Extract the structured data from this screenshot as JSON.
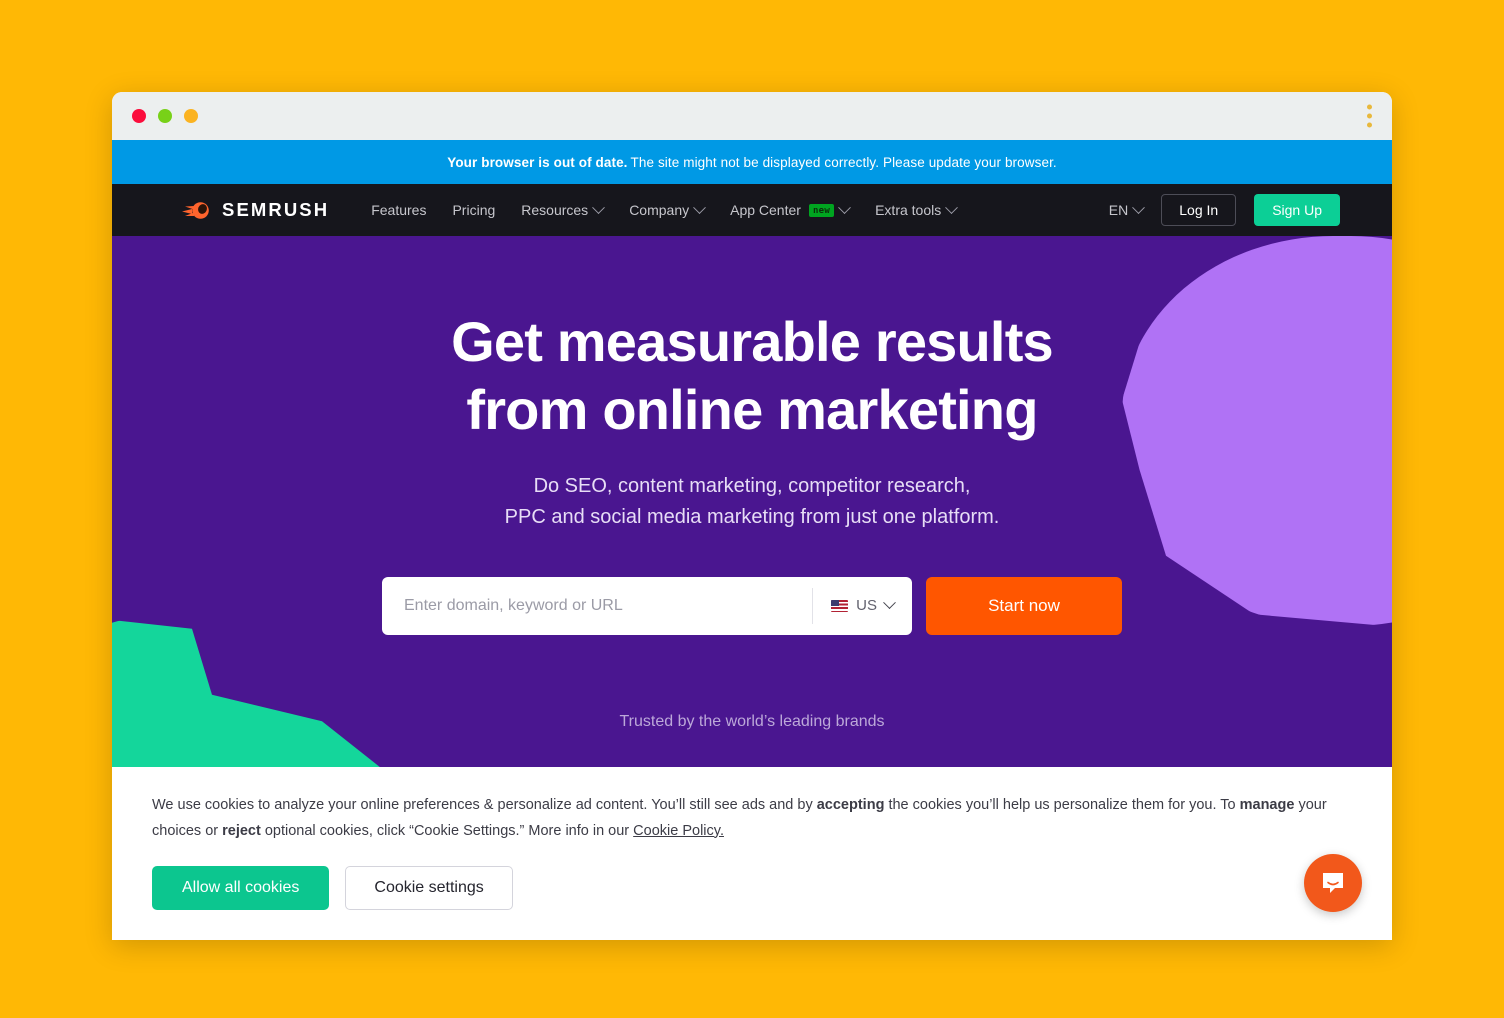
{
  "page": {
    "background_color": "#FFB805"
  },
  "browser": {
    "traffic_lights": [
      "close",
      "minimize",
      "maximize"
    ],
    "menu_icon": "kebab-menu-icon"
  },
  "notice": {
    "bold": "Your browser is out of date.",
    "rest": "The site might not be displayed correctly. Please update your browser.",
    "background_color": "#0099E5"
  },
  "nav": {
    "background_color": "#16161C",
    "logo_text": "SEMRUSH",
    "links": [
      {
        "label": "Features",
        "has_chevron": false,
        "badge": null
      },
      {
        "label": "Pricing",
        "has_chevron": false,
        "badge": null
      },
      {
        "label": "Resources",
        "has_chevron": true,
        "badge": null
      },
      {
        "label": "Company",
        "has_chevron": true,
        "badge": null
      },
      {
        "label": "App Center",
        "has_chevron": true,
        "badge": "new"
      },
      {
        "label": "Extra tools",
        "has_chevron": true,
        "badge": null
      }
    ],
    "language": "EN",
    "login_label": "Log In",
    "signup_label": "Sign Up",
    "signup_color": "#0CCF96"
  },
  "hero": {
    "background_color": "#4A1690",
    "title_line1": "Get measurable results",
    "title_line2": "from online marketing",
    "subtitle_line1": "Do SEO, content marketing, competitor research,",
    "subtitle_line2": "PPC and social media marketing from just one platform.",
    "trusted_text": "Trusted by the world’s leading brands",
    "blob_purple_color": "#B072F5",
    "blob_teal_color": "#14D69B"
  },
  "search": {
    "placeholder": "Enter domain, keyword or URL",
    "value": "",
    "country_code": "US",
    "country_flag": "us-flag-icon",
    "button_label": "Start now",
    "button_color": "#FF5600"
  },
  "cookie": {
    "t1": "We use cookies to analyze your online preferences & personalize ad content. You’ll still see ads and by ",
    "b1": "accepting",
    "t2": " the cookies you’ll help us personalize them for you. To ",
    "b2": "manage",
    "t3": " your choices or ",
    "b3": "reject",
    "t4": " optional cookies, click “Cookie Settings.” More info in our ",
    "link": "Cookie Policy.",
    "allow_label": "Allow all cookies",
    "settings_label": "Cookie settings",
    "allow_color": "#0CC68F"
  },
  "chat": {
    "icon": "intercom-chat-icon",
    "color": "#F2581B"
  }
}
